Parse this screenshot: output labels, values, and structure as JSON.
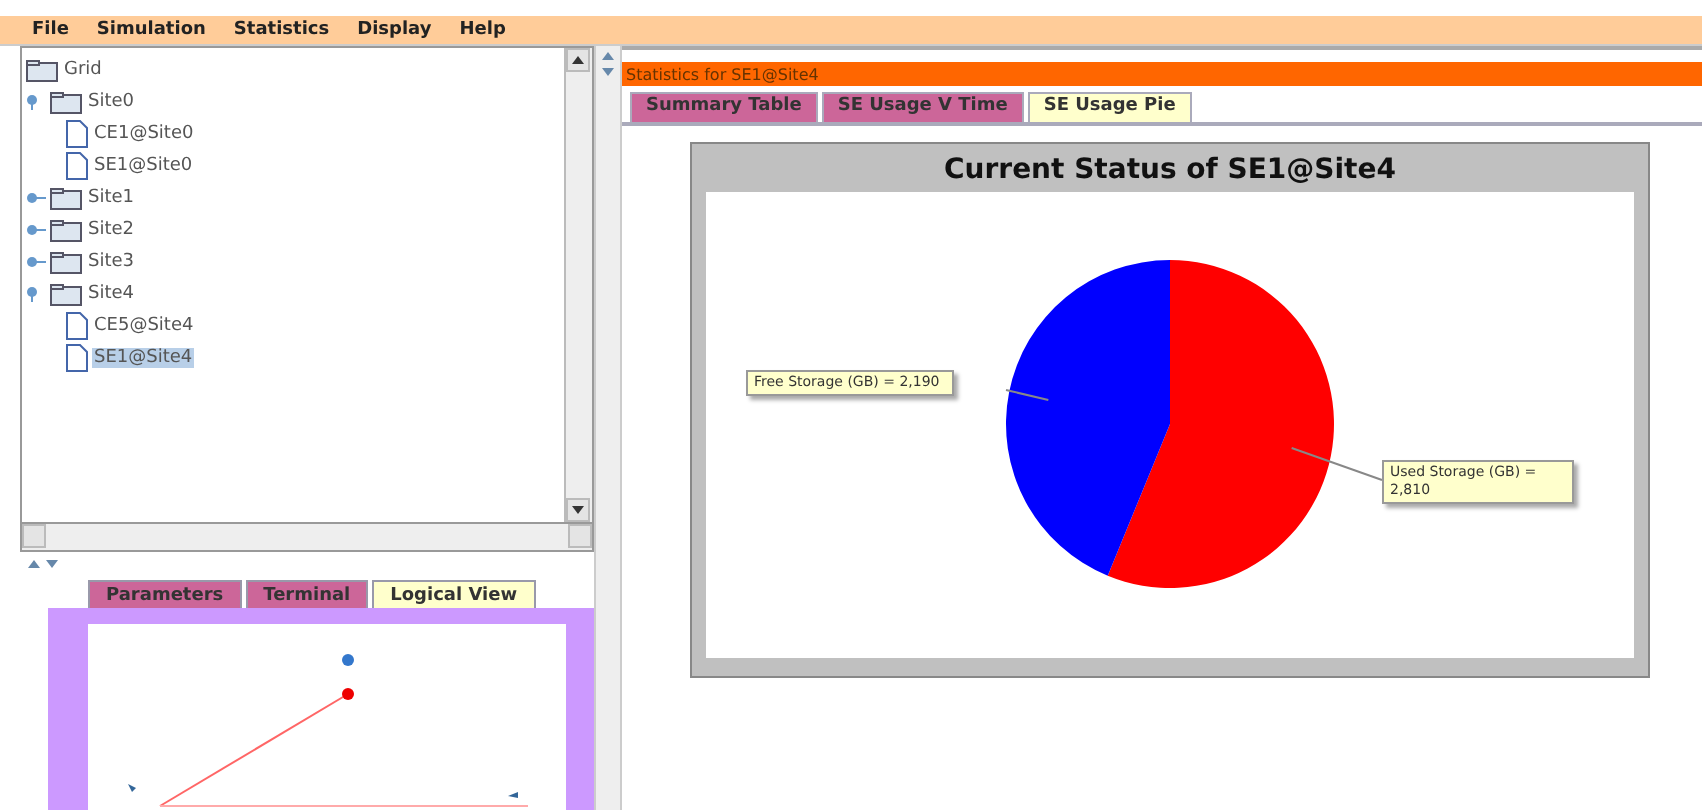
{
  "menu": [
    {
      "label": "File"
    },
    {
      "label": "Simulation"
    },
    {
      "label": "Statistics"
    },
    {
      "label": "Display"
    },
    {
      "label": "Help"
    }
  ],
  "tree": {
    "label": "Grid",
    "kind": "folder",
    "selected": false,
    "children": [
      {
        "label": "Site0",
        "kind": "folder",
        "expanded": true,
        "selected": false,
        "children": [
          {
            "label": "CE1@Site0",
            "kind": "file",
            "selected": false
          },
          {
            "label": "SE1@Site0",
            "kind": "file",
            "selected": false
          }
        ]
      },
      {
        "label": "Site1",
        "kind": "folder",
        "expanded": false,
        "selected": false
      },
      {
        "label": "Site2",
        "kind": "folder",
        "expanded": false,
        "selected": false
      },
      {
        "label": "Site3",
        "kind": "folder",
        "expanded": false,
        "selected": false
      },
      {
        "label": "Site4",
        "kind": "folder",
        "expanded": true,
        "selected": false,
        "children": [
          {
            "label": "CE5@Site4",
            "kind": "file",
            "selected": false
          },
          {
            "label": "SE1@Site4",
            "kind": "file",
            "selected": true
          }
        ]
      }
    ]
  },
  "bottom_tabs": [
    {
      "label": "Parameters",
      "selected": false
    },
    {
      "label": "Terminal",
      "selected": false
    },
    {
      "label": "Logical View",
      "selected": true
    }
  ],
  "stats_title": "Statistics for SE1@Site4",
  "stats_tabs": [
    {
      "label": "Summary Table",
      "selected": false
    },
    {
      "label": "SE Usage V Time",
      "selected": false
    },
    {
      "label": "SE Usage Pie",
      "selected": true
    }
  ],
  "chart": {
    "title": "Current Status of SE1@Site4",
    "chart_data": {
      "type": "pie",
      "values": [
        2810,
        2190
      ],
      "colors": [
        "#ff0000",
        "#0000ff"
      ],
      "value_labels": [
        "Used Storage (GB) = 2,810",
        "Free Storage (GB) = 2,190"
      ]
    }
  }
}
